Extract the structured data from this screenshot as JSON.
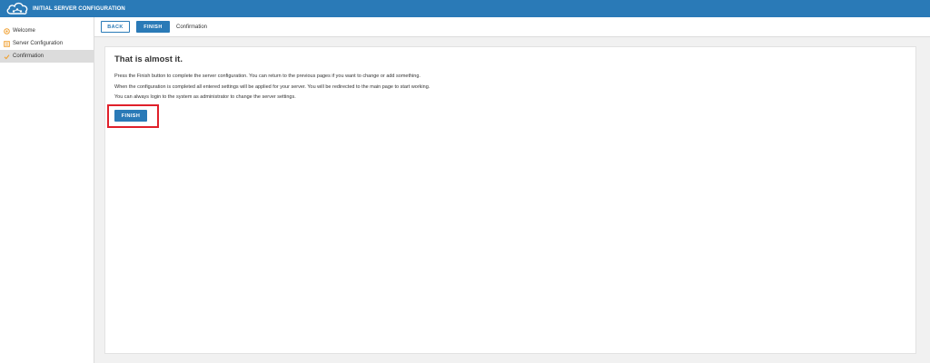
{
  "app": {
    "title": "INITIAL SERVER CONFIGURATION",
    "logo_icon": "cloud-icon"
  },
  "sidebar": {
    "items": [
      {
        "label": "Welcome",
        "icon": "circle-icon",
        "icon_color": "#f0a030",
        "active": false
      },
      {
        "label": "Server Configuration",
        "icon": "list-icon",
        "icon_color": "#f0a030",
        "active": false
      },
      {
        "label": "Confirmation",
        "icon": "check-icon",
        "icon_color": "#f0a030",
        "active": true
      }
    ]
  },
  "toolbar": {
    "back_label": "BACK",
    "finish_label": "FINISH",
    "breadcrumb": "Confirmation"
  },
  "content": {
    "heading": "That is almost it.",
    "paragraphs": [
      "Press the Finish button to complete the server configuration. You can return to the previous pages if you want to change or add something.",
      "When the configuration is completed all entered settings will be applied for your server. You will be redirected to the main page to start working.",
      "You can always login to the system as administrator to change the server settings."
    ],
    "finish_label": "FINISH"
  },
  "colors": {
    "accent": "#2a7ab7",
    "highlight": "#e0202a",
    "icon": "#f0a030"
  }
}
